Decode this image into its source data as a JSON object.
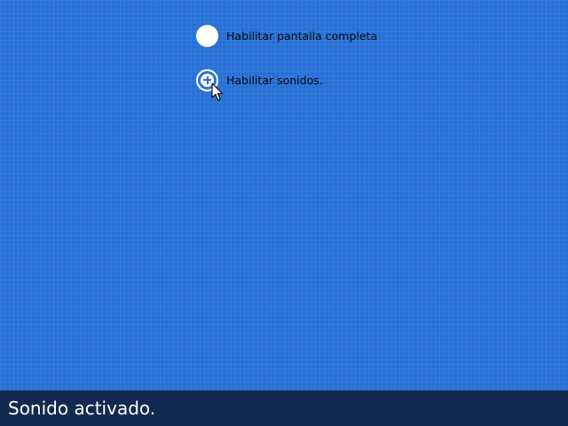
{
  "options": [
    {
      "label": "Habilitar pantalla completa",
      "state": "off",
      "icon": "circle-icon"
    },
    {
      "label": "Habilitar sonidos.",
      "state": "on",
      "icon": "plus-circle-icon"
    }
  ],
  "status": {
    "message": "Sonido activado."
  },
  "colors": {
    "background": "#2770d6",
    "status_bar": "#13294f",
    "toggle": "#ffffff",
    "label_text": "#0a0a0a"
  },
  "pointer": {
    "icon": "mouse-pointer-icon"
  }
}
